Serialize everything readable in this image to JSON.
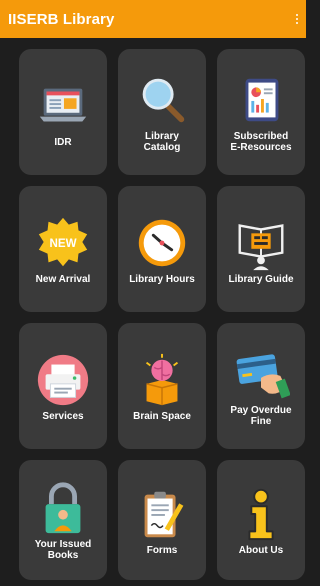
{
  "app": {
    "title": "IISERB Library"
  },
  "tiles": [
    {
      "label": "IDR",
      "icon": "laptop-icon"
    },
    {
      "label": "Library\nCatalog",
      "icon": "magnifier-icon"
    },
    {
      "label": "Subscribed\nE-Resources",
      "icon": "tablet-report-icon"
    },
    {
      "label": "New Arrival",
      "icon": "new-badge-icon"
    },
    {
      "label": "Library Hours",
      "icon": "clock-icon"
    },
    {
      "label": "Library Guide",
      "icon": "book-person-icon"
    },
    {
      "label": "Services",
      "icon": "printer-icon"
    },
    {
      "label": "Brain Space",
      "icon": "brain-box-icon"
    },
    {
      "label": "Pay Overdue\nFine",
      "icon": "credit-card-icon"
    },
    {
      "label": "Your Issued\nBooks",
      "icon": "lock-person-icon"
    },
    {
      "label": "Forms",
      "icon": "clipboard-icon"
    },
    {
      "label": "About Us",
      "icon": "info-icon"
    }
  ]
}
